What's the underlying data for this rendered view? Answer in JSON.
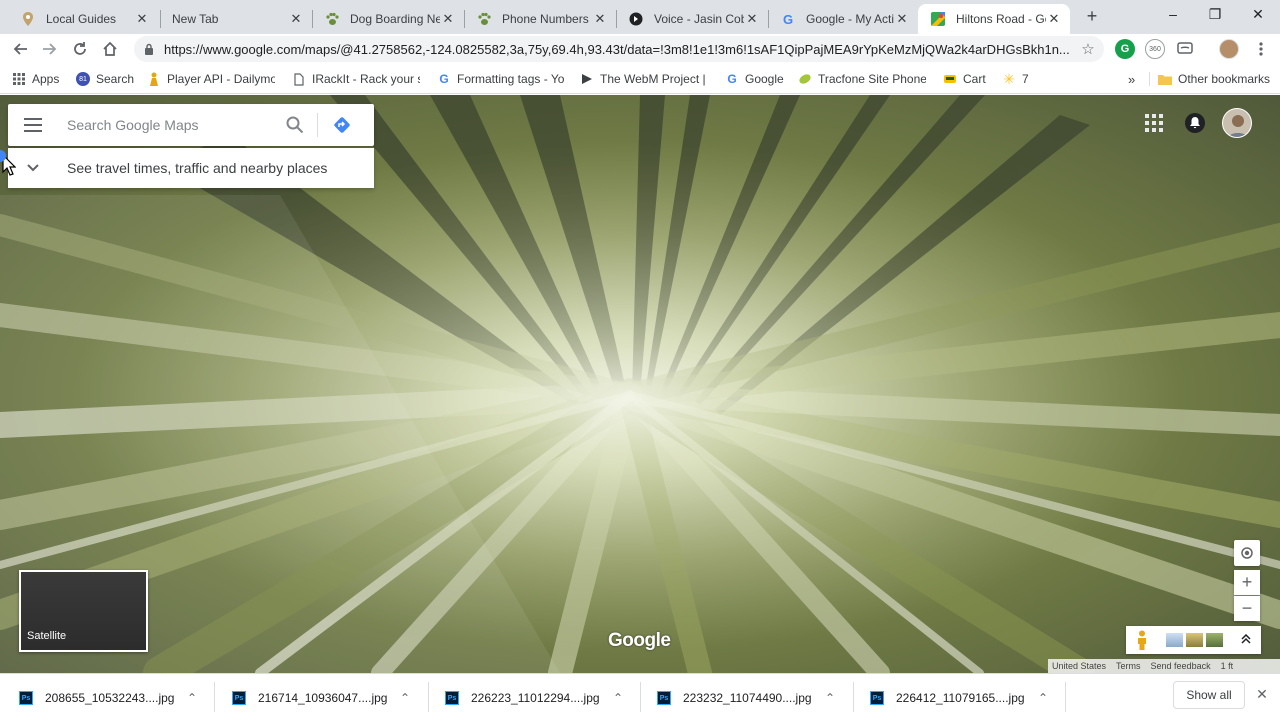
{
  "tabs": [
    {
      "title": "Local Guides",
      "icon": "map-pin-icon"
    },
    {
      "title": "New Tab",
      "icon": "none"
    },
    {
      "title": "Dog Boarding Ne",
      "icon": "paw-icon"
    },
    {
      "title": "Phone Numbers |",
      "icon": "paw-icon"
    },
    {
      "title": "Voice - Jasin Cobu",
      "icon": "voice-icon"
    },
    {
      "title": "Google - My Activ",
      "icon": "google-icon"
    },
    {
      "title": "Hiltons Road - Go",
      "icon": "maps-icon",
      "active": true
    }
  ],
  "new_tab_symbol": "+",
  "window_controls": {
    "minimize": "–",
    "maximize": "❐",
    "close": "✕"
  },
  "toolbar": {
    "url": "https://www.google.com/maps/@41.2758562,-124.0825582,3a,75y,69.4h,93.43t/data=!3m8!1e1!3m6!1sAF1QipPajMEA9rYpKeMzMjQWa2k4arDHGsBkh1n..."
  },
  "bookmarks": [
    {
      "label": "Apps",
      "icon": "apps-grid-icon"
    },
    {
      "label": "Search",
      "icon": "search-badge-icon"
    },
    {
      "label": "Player API - Dailymot",
      "icon": "person-icon"
    },
    {
      "label": "IRackIt - Rack your st",
      "icon": "page-icon"
    },
    {
      "label": "Formatting tags - You",
      "icon": "google-icon"
    },
    {
      "label": "The WebM Project | V",
      "icon": "play-icon"
    },
    {
      "label": "Google",
      "icon": "google-icon"
    },
    {
      "label": "Tracfone Site Phone C",
      "icon": "leaf-icon"
    },
    {
      "label": "Cart",
      "icon": "cart-icon"
    },
    {
      "label": "7",
      "icon": "walmart-icon"
    }
  ],
  "bookmarks_overflow": "»",
  "other_bookmarks": "Other bookmarks",
  "maps": {
    "search_placeholder": "Search Google Maps",
    "travel_prompt": "See travel times, traffic and nearby places",
    "layer_label": "Satellite",
    "logo": "Google",
    "attribution": [
      "United States",
      "Terms",
      "Send feedback",
      "1 ft"
    ],
    "zoom_in": "+",
    "zoom_out": "−"
  },
  "downloads": [
    {
      "name": "208655_10532243....jpg"
    },
    {
      "name": "216714_10936047....jpg"
    },
    {
      "name": "226223_11012294....jpg"
    },
    {
      "name": "223232_11074490....jpg"
    },
    {
      "name": "226412_11079165....jpg"
    }
  ],
  "show_all": "Show all"
}
